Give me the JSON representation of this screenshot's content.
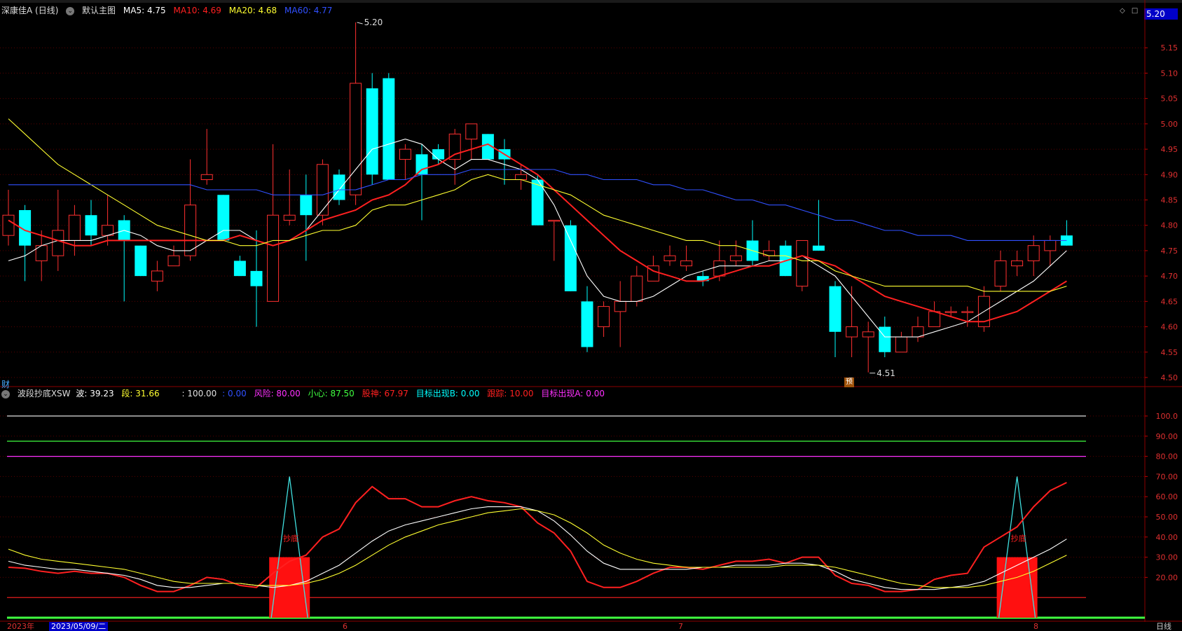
{
  "main_header": {
    "stock": "深康佳A (日线)",
    "layout": "默认主图",
    "ma5": "MA5: 4.75",
    "ma10": "MA10: 4.69",
    "ma20": "MA20: 4.68",
    "ma60": "MA60: 4.77",
    "colors": {
      "ma5": "#ffffff",
      "ma10": "#ff2020",
      "ma20": "#ffff30",
      "ma60": "#3050ff"
    }
  },
  "indicator_header": {
    "name": "波段抄底XSW",
    "bo": "波: 39.23",
    "duan": "段: 31.66",
    "hundred": ": 100.00",
    "zero": ": 0.00",
    "fengxian": "风险: 80.00",
    "xiaoxin": "小心: 87.50",
    "gushen": "股神: 67.97",
    "target_b": "目标出现B: 0.00",
    "genzong": "跟踪: 10.00",
    "target_a": "目标出现A: 0.00",
    "colors": {
      "bo": "#ffffff",
      "duan": "#ffff30",
      "zero": "#3050ff",
      "fengxian": "#ff30ff",
      "xiaoxin": "#40ff40",
      "gushen": "#ff2020",
      "target_b": "#00ffff",
      "genzong": "#ff2020",
      "target_a": "#ff30ff"
    }
  },
  "price_tag": "5.20",
  "badges": {
    "cai": "财",
    "yu": "预"
  },
  "bottom": {
    "year": "2023年",
    "selected_date": "2023/05/09/二",
    "m6": "6",
    "m7": "7",
    "m8": "8",
    "period": "日线"
  },
  "icons": [
    "collapse-icon",
    "diamond-icon",
    "square-icon"
  ],
  "chart_data": [
    {
      "type": "candlestick",
      "title": "深康佳A (日线)",
      "ylim": [
        4.48,
        5.22
      ],
      "y_ticks": [
        "5.15",
        "5.10",
        "5.05",
        "5.00",
        "4.95",
        "4.90",
        "4.85",
        "4.80",
        "4.75",
        "4.70",
        "4.65",
        "4.60",
        "4.55",
        "4.50"
      ],
      "annotations": {
        "high": "5.20",
        "low": "4.51"
      },
      "candles": [
        [
          4.78,
          4.82,
          4.87,
          4.76
        ],
        [
          4.83,
          4.76,
          4.84,
          4.69
        ],
        [
          4.73,
          4.76,
          4.79,
          4.69
        ],
        [
          4.74,
          4.79,
          4.87,
          4.71
        ],
        [
          4.77,
          4.82,
          4.84,
          4.74
        ],
        [
          4.82,
          4.78,
          4.85,
          4.76
        ],
        [
          4.78,
          4.8,
          4.86,
          4.76
        ],
        [
          4.81,
          4.77,
          4.82,
          4.65
        ],
        [
          4.76,
          4.7,
          4.76,
          4.7
        ],
        [
          4.69,
          4.71,
          4.73,
          4.67
        ],
        [
          4.72,
          4.74,
          4.76,
          4.72
        ],
        [
          4.74,
          4.84,
          4.93,
          4.73
        ],
        [
          4.89,
          4.9,
          4.99,
          4.88
        ],
        [
          4.86,
          4.77,
          4.86,
          4.77
        ],
        [
          4.73,
          4.7,
          4.74,
          4.7
        ],
        [
          4.71,
          4.68,
          4.79,
          4.6
        ],
        [
          4.65,
          4.82,
          4.96,
          4.65
        ],
        [
          4.81,
          4.82,
          4.91,
          4.8
        ],
        [
          4.86,
          4.82,
          4.9,
          4.73
        ],
        [
          4.82,
          4.92,
          4.93,
          4.8
        ],
        [
          4.9,
          4.85,
          4.91,
          4.84
        ],
        [
          4.86,
          5.08,
          5.2,
          4.84
        ],
        [
          5.07,
          4.9,
          5.1,
          4.88
        ],
        [
          5.09,
          4.89,
          5.1,
          4.89
        ],
        [
          4.93,
          4.95,
          4.96,
          4.89
        ],
        [
          4.94,
          4.9,
          4.96,
          4.81
        ],
        [
          4.95,
          4.93,
          4.96,
          4.92
        ],
        [
          4.93,
          4.98,
          4.99,
          4.88
        ],
        [
          4.97,
          5.0,
          5.0,
          4.93
        ],
        [
          4.98,
          4.93,
          4.98,
          4.93
        ],
        [
          4.95,
          4.93,
          4.97,
          4.88
        ],
        [
          4.89,
          4.9,
          4.92,
          4.87
        ],
        [
          4.89,
          4.8,
          4.9,
          4.8
        ],
        [
          4.81,
          4.81,
          4.81,
          4.73
        ],
        [
          4.8,
          4.67,
          4.81,
          4.67
        ],
        [
          4.65,
          4.56,
          4.68,
          4.55
        ],
        [
          4.6,
          4.64,
          4.65,
          4.58
        ],
        [
          4.63,
          4.65,
          4.69,
          4.56
        ],
        [
          4.65,
          4.7,
          4.72,
          4.64
        ],
        [
          4.69,
          4.72,
          4.74,
          4.69
        ],
        [
          4.73,
          4.74,
          4.76,
          4.72
        ],
        [
          4.72,
          4.73,
          4.76,
          4.71
        ],
        [
          4.7,
          4.69,
          4.71,
          4.68
        ],
        [
          4.7,
          4.73,
          4.77,
          4.69
        ],
        [
          4.73,
          4.74,
          4.77,
          4.72
        ],
        [
          4.77,
          4.73,
          4.81,
          4.72
        ],
        [
          4.74,
          4.75,
          4.77,
          4.73
        ],
        [
          4.76,
          4.7,
          4.77,
          4.7
        ],
        [
          4.68,
          4.77,
          4.77,
          4.67
        ],
        [
          4.76,
          4.75,
          4.85,
          4.75
        ],
        [
          4.68,
          4.59,
          4.69,
          4.54
        ],
        [
          4.58,
          4.6,
          4.68,
          4.54
        ],
        [
          4.58,
          4.59,
          4.61,
          4.51
        ],
        [
          4.6,
          4.55,
          4.62,
          4.54
        ],
        [
          4.55,
          4.58,
          4.59,
          4.55
        ],
        [
          4.58,
          4.6,
          4.62,
          4.57
        ],
        [
          4.6,
          4.63,
          4.65,
          4.6
        ],
        [
          4.63,
          4.63,
          4.64,
          4.62
        ],
        [
          4.63,
          4.63,
          4.64,
          4.6
        ],
        [
          4.6,
          4.66,
          4.68,
          4.59
        ],
        [
          4.68,
          4.73,
          4.75,
          4.67
        ],
        [
          4.72,
          4.73,
          4.75,
          4.7
        ],
        [
          4.73,
          4.76,
          4.78,
          4.7
        ],
        [
          4.75,
          4.77,
          4.78,
          4.72
        ],
        [
          4.78,
          4.76,
          4.81,
          4.76
        ]
      ],
      "series": [
        {
          "name": "MA5",
          "color": "#ffffff",
          "values": [
            4.73,
            4.74,
            4.76,
            4.77,
            4.77,
            4.77,
            4.78,
            4.79,
            4.78,
            4.76,
            4.75,
            4.75,
            4.77,
            4.79,
            4.79,
            4.77,
            4.76,
            4.77,
            4.79,
            4.83,
            4.87,
            4.91,
            4.95,
            4.96,
            4.97,
            4.96,
            4.93,
            4.91,
            4.93,
            4.93,
            4.92,
            4.91,
            4.89,
            4.84,
            4.77,
            4.7,
            4.66,
            4.65,
            4.65,
            4.66,
            4.68,
            4.7,
            4.71,
            4.72,
            4.72,
            4.72,
            4.73,
            4.73,
            4.74,
            4.72,
            4.7,
            4.66,
            4.62,
            4.58,
            4.58,
            4.58,
            4.59,
            4.6,
            4.61,
            4.63,
            4.65,
            4.67,
            4.69,
            4.72,
            4.75
          ]
        },
        {
          "name": "MA10",
          "color": "#ff2020",
          "values": [
            4.81,
            4.79,
            4.78,
            4.77,
            4.76,
            4.76,
            4.77,
            4.77,
            4.77,
            4.77,
            4.77,
            4.77,
            4.77,
            4.77,
            4.78,
            4.77,
            4.76,
            4.77,
            4.79,
            4.81,
            4.82,
            4.83,
            4.85,
            4.86,
            4.88,
            4.91,
            4.92,
            4.94,
            4.95,
            4.96,
            4.94,
            4.92,
            4.9,
            4.87,
            4.84,
            4.81,
            4.78,
            4.75,
            4.73,
            4.71,
            4.7,
            4.69,
            4.69,
            4.7,
            4.71,
            4.72,
            4.72,
            4.73,
            4.74,
            4.73,
            4.72,
            4.7,
            4.68,
            4.66,
            4.65,
            4.64,
            4.63,
            4.62,
            4.61,
            4.61,
            4.62,
            4.63,
            4.65,
            4.67,
            4.69
          ]
        },
        {
          "name": "MA20",
          "color": "#ffff30",
          "values": [
            5.01,
            4.98,
            4.95,
            4.92,
            4.9,
            4.88,
            4.86,
            4.84,
            4.82,
            4.8,
            4.79,
            4.78,
            4.77,
            4.77,
            4.76,
            4.76,
            4.77,
            4.77,
            4.78,
            4.79,
            4.79,
            4.8,
            4.83,
            4.84,
            4.84,
            4.85,
            4.86,
            4.87,
            4.89,
            4.9,
            4.89,
            4.89,
            4.88,
            4.87,
            4.86,
            4.84,
            4.82,
            4.81,
            4.8,
            4.79,
            4.78,
            4.77,
            4.77,
            4.76,
            4.76,
            4.75,
            4.74,
            4.74,
            4.73,
            4.73,
            4.71,
            4.7,
            4.69,
            4.68,
            4.68,
            4.68,
            4.68,
            4.68,
            4.68,
            4.67,
            4.67,
            4.67,
            4.67,
            4.67,
            4.68
          ]
        },
        {
          "name": "MA60",
          "color": "#3050ff",
          "values": [
            4.88,
            4.88,
            4.88,
            4.88,
            4.88,
            4.88,
            4.88,
            4.88,
            4.88,
            4.88,
            4.88,
            4.88,
            4.87,
            4.87,
            4.87,
            4.87,
            4.86,
            4.86,
            4.86,
            4.86,
            4.87,
            4.87,
            4.88,
            4.89,
            4.89,
            4.9,
            4.9,
            4.9,
            4.91,
            4.91,
            4.91,
            4.91,
            4.91,
            4.91,
            4.9,
            4.9,
            4.89,
            4.89,
            4.89,
            4.88,
            4.88,
            4.87,
            4.87,
            4.86,
            4.85,
            4.85,
            4.84,
            4.84,
            4.83,
            4.82,
            4.81,
            4.81,
            4.8,
            4.79,
            4.79,
            4.78,
            4.78,
            4.78,
            4.77,
            4.77,
            4.77,
            4.77,
            4.77,
            4.77,
            4.77
          ]
        }
      ]
    },
    {
      "type": "line",
      "title": "波段抄底XSW",
      "ylim": [
        0,
        105
      ],
      "y_ticks": [
        "100.0",
        "90.00",
        "80.00",
        "70.00",
        "60.00",
        "50.00",
        "40.00",
        "30.00",
        "20.00"
      ],
      "hlines": [
        {
          "name": "100",
          "value": 100,
          "color": "#e0e0e0"
        },
        {
          "name": "小心",
          "value": 87.5,
          "color": "#40ff40"
        },
        {
          "name": "风险",
          "value": 80,
          "color": "#ff30ff"
        },
        {
          "name": "跟踪",
          "value": 10,
          "color": "#ff2020"
        },
        {
          "name": "0",
          "value": 0,
          "color": "#40ff40"
        }
      ],
      "signals": [
        {
          "label": "抄底",
          "index": 17,
          "bar_height": 30,
          "spike": 70
        },
        {
          "label": "抄底",
          "index": 61,
          "bar_height": 30,
          "spike": 70
        }
      ],
      "series": [
        {
          "name": "股神",
          "color": "#ff2020",
          "values": [
            25,
            24.5,
            23,
            22,
            23,
            22,
            22,
            20,
            16,
            13,
            13,
            16,
            20,
            19,
            16,
            15,
            22,
            28,
            31,
            40,
            44,
            57,
            65,
            59,
            59,
            55,
            55,
            58,
            60,
            58,
            57,
            55,
            47,
            42,
            33,
            18,
            15,
            15,
            18,
            22,
            25,
            25,
            24,
            26,
            28,
            28,
            29,
            27,
            30,
            30,
            21,
            17,
            16,
            13,
            13,
            14,
            19,
            21,
            22,
            35,
            40,
            45,
            55,
            63,
            67
          ]
        },
        {
          "name": "波",
          "color": "#ffffff",
          "values": [
            28,
            26,
            25,
            24,
            24,
            23,
            22,
            21,
            19,
            16,
            15,
            15,
            16,
            17,
            17,
            16,
            15,
            16,
            18,
            22,
            26,
            32,
            38,
            43,
            46,
            48,
            50,
            52,
            54,
            55,
            55,
            55,
            53,
            48,
            41,
            33,
            27,
            24,
            24,
            24,
            24,
            24,
            25,
            25,
            26,
            26,
            26,
            27,
            27,
            26,
            23,
            19,
            17,
            15,
            14,
            14,
            14,
            15,
            16,
            18,
            22,
            26,
            30,
            34,
            39
          ]
        },
        {
          "name": "段",
          "color": "#ffff30",
          "values": [
            34,
            31,
            29,
            28,
            27,
            26,
            25,
            24,
            22,
            20,
            18,
            17,
            17,
            17,
            17,
            16,
            16,
            16,
            17,
            19,
            22,
            26,
            31,
            36,
            40,
            43,
            46,
            48,
            50,
            52,
            53,
            54,
            53,
            51,
            47,
            42,
            36,
            32,
            29,
            27,
            26,
            25,
            25,
            25,
            25,
            25,
            25,
            26,
            26,
            26,
            25,
            23,
            21,
            19,
            17,
            16,
            15,
            15,
            15,
            16,
            18,
            20,
            23,
            27,
            31
          ]
        }
      ]
    }
  ]
}
